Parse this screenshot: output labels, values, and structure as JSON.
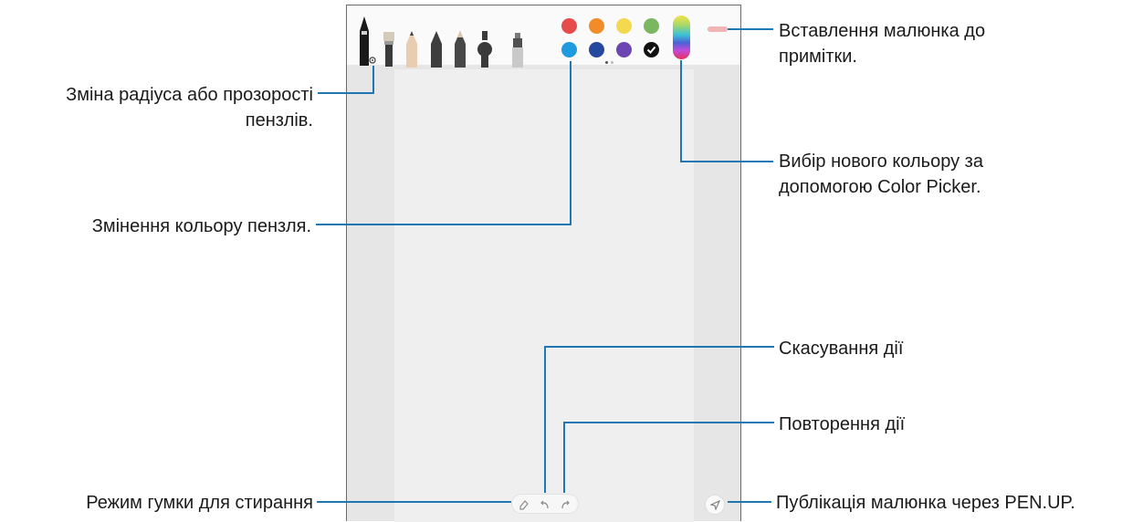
{
  "callouts": {
    "insert_drawing": "Вставлення малюнка до примітки.",
    "brush_size": "Зміна радіуса або прозорості пензлів.",
    "color_picker": "Вибір нового кольору за допомогою Color Picker.",
    "brush_color": "Змінення кольору пензля.",
    "undo": "Скасування дії",
    "redo": "Повторення дії",
    "eraser": "Режим гумки для стирання",
    "penup": "Публікація малюнка через PEN.UP."
  },
  "toolbar": {
    "brushes": [
      "fountain-pen",
      "calligraphy-brush",
      "pencil",
      "marker",
      "crayon",
      "airbrush",
      "highlighter"
    ],
    "palette": [
      "#e74c4c",
      "#f28c28",
      "#f2d94e",
      "#7bb661",
      "#1e9be0",
      "#2447a0",
      "#6d46b3",
      "#111111"
    ],
    "selected_color_index": 7,
    "page_indicator_count": 2,
    "page_indicator_active": 0
  },
  "icons": {
    "settings": "gear-icon",
    "eraser": "eraser-icon",
    "undo": "undo-icon",
    "redo": "redo-icon",
    "share": "send-icon"
  }
}
